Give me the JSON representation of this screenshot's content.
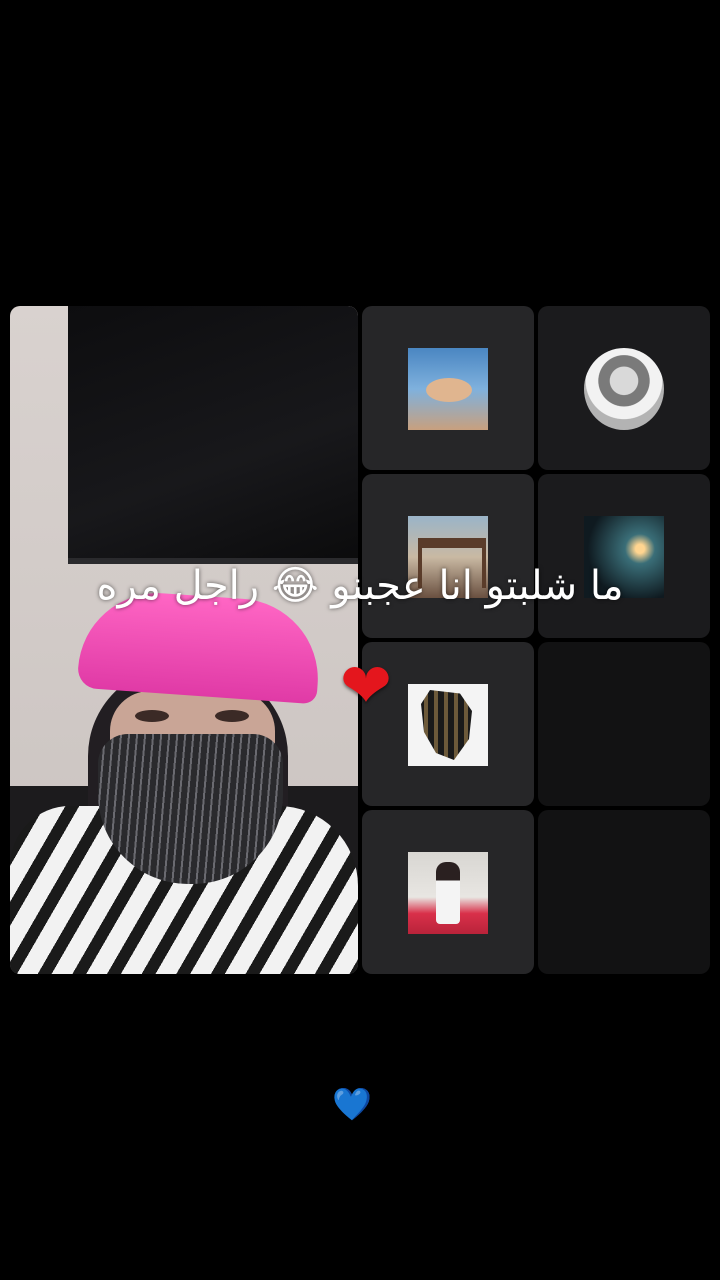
{
  "live_room": {
    "overlay_comment": "ما شلبتو انا عجبنو 😂 راجل مره",
    "reaction_heart": "❤",
    "reaction_blue_heart": "💙"
  },
  "seats": [
    {
      "avatar": "hands-holding-ring"
    },
    {
      "avatar": "man-in-ghutra"
    },
    {
      "avatar": "wooden-gazebo"
    },
    {
      "avatar": "night-street"
    },
    {
      "avatar": "map-silhouette"
    },
    {
      "avatar": "empty"
    },
    {
      "avatar": "person-in-white-robe"
    },
    {
      "avatar": "empty"
    }
  ],
  "colors": {
    "background": "#000000",
    "seat_tile": "#262628",
    "cap_pink": "#ff66c4",
    "heart_red": "#e4161d",
    "heart_blue": "#4fa3ff"
  }
}
